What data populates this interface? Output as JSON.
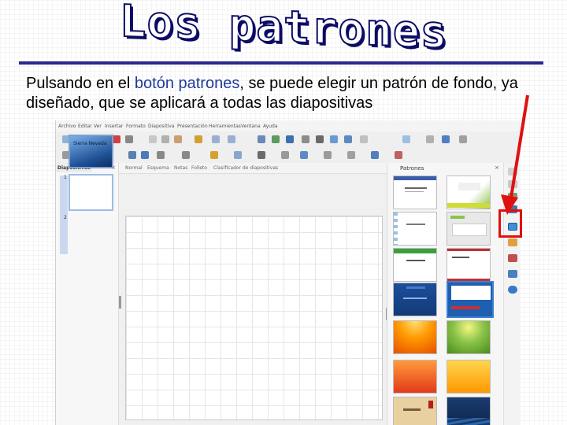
{
  "slide": {
    "title": "Los patrones",
    "description_parts": [
      "Pulsando en el ",
      "botón patrones",
      ", se puede elegir un patrón de fondo, ya diseñado, que se aplicará a todas las diapositivas"
    ]
  },
  "app": {
    "menu": [
      "Archivo",
      "Editar",
      "Ver",
      "Insertar",
      "Formato",
      "Diapositiva",
      "Presentación",
      "Herramientas",
      "Ventana",
      "Ayuda"
    ],
    "slides_panel": {
      "title": "Diapositivas",
      "close": "×",
      "slides": [
        {
          "number": "1",
          "text": "Sierra Nevada"
        },
        {
          "number": "2",
          "text": ""
        }
      ]
    },
    "view_tabs": [
      "Normal",
      "Esquema",
      "Notas",
      "Folleto",
      "Clasificador de diapositivas"
    ],
    "patterns_panel": {
      "title": "Patrones",
      "close": "×",
      "templates": [
        {
          "label": "",
          "style": "white-blue-header",
          "selected": false
        },
        {
          "label": "",
          "style": "green-swirl",
          "selected": false
        },
        {
          "label": "",
          "style": "white-wave",
          "selected": false
        },
        {
          "label": "",
          "style": "gray-green-bar",
          "selected": false
        },
        {
          "label": "",
          "style": "green-header",
          "selected": false
        },
        {
          "label": "",
          "style": "white-red-stripe",
          "selected": false
        },
        {
          "label": "",
          "style": "blue-dark",
          "selected": false
        },
        {
          "label": "",
          "style": "blue-red",
          "selected": true
        },
        {
          "label": "",
          "style": "orange-sunburst",
          "selected": false
        },
        {
          "label": "",
          "style": "green-gradient",
          "selected": false
        },
        {
          "label": "",
          "style": "red-orange",
          "selected": false
        },
        {
          "label": "",
          "style": "yellow-orange",
          "selected": false
        },
        {
          "label": "",
          "style": "beige-red",
          "selected": false
        },
        {
          "label": "",
          "style": "blue-waves",
          "selected": false
        }
      ]
    },
    "sidebar_icons": [
      "properties-icon",
      "styles-icon",
      "gallery-icon",
      "navigator-icon",
      "patterns-icon",
      "animation-icon",
      "transition-icon",
      "shapes-icon",
      "help-icon"
    ]
  },
  "colors": {
    "title_outline": "#0c0c66",
    "rule": "#2a2a8c",
    "highlight_text": "#1f3a9a",
    "callout": "#e01010"
  }
}
